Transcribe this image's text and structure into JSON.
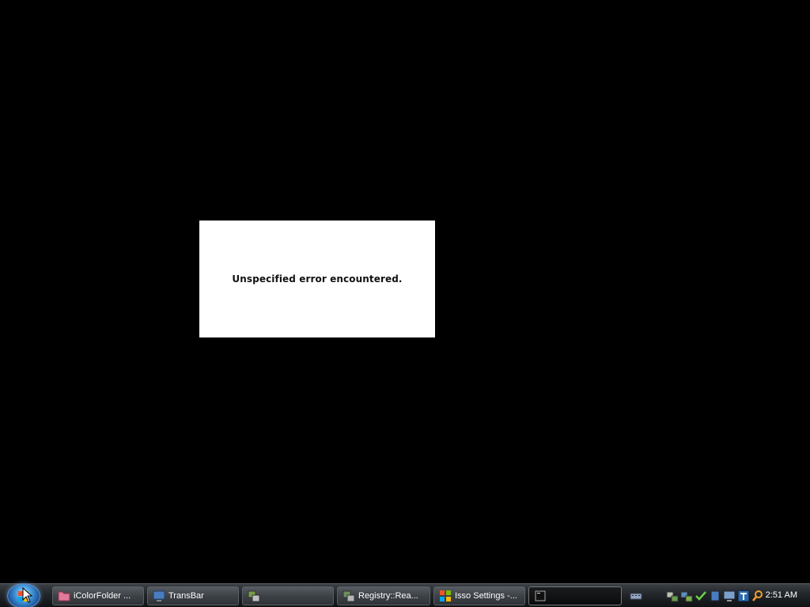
{
  "error_dialog": {
    "message": "Unspecified error encountered."
  },
  "taskbar": {
    "start_button": {
      "icon": "windows-logo-icon"
    },
    "buttons": [
      {
        "label": "iColorFolder ...",
        "icon": "folder-icon",
        "active": false
      },
      {
        "label": "TransBar",
        "icon": "monitor-icon",
        "active": false
      },
      {
        "label": "",
        "icon": "app-window-icon",
        "active": false
      },
      {
        "label": "Registry::Rea...",
        "icon": "registry-icon",
        "active": false
      },
      {
        "label": "Isso Settings -...",
        "icon": "settings-icon",
        "active": false
      },
      {
        "label": "",
        "icon": "terminal-icon",
        "active": true
      }
    ],
    "tray_icons": [
      "keyboard-icon",
      "network-icon",
      "network2-icon",
      "checkmark-icon",
      "volume-icon",
      "monitor-tray-icon",
      "text-icon",
      "search-icon"
    ],
    "clock": "2:51 AM"
  },
  "colors": {
    "desktop": "#000000",
    "dialog": "#ffffff"
  }
}
